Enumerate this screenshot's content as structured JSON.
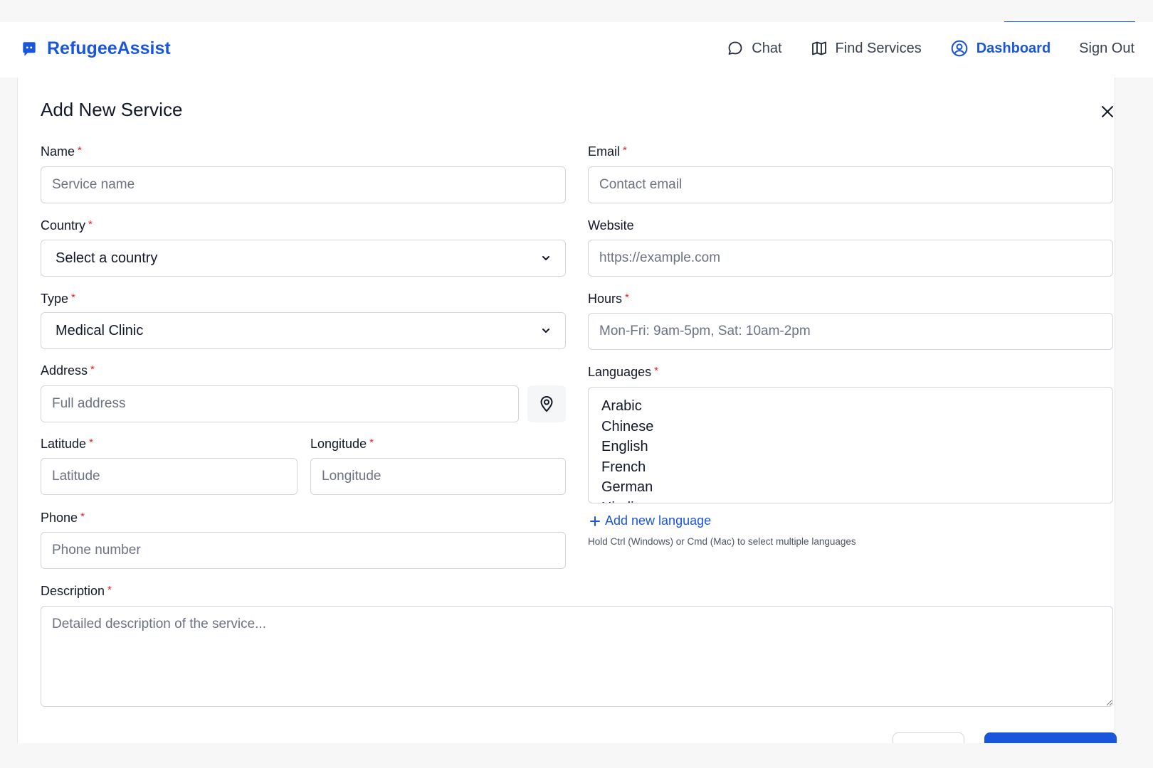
{
  "app": {
    "brand_name": "RefugeeAssist",
    "brand_icon": "chat-bot-icon",
    "brand_color": "#1a56db"
  },
  "nav": {
    "items": [
      {
        "label": "Chat",
        "icon": "chat-bubble-icon"
      },
      {
        "label": "Find Services",
        "icon": "map-icon"
      },
      {
        "label": "Dashboard",
        "icon": "user-circle-icon",
        "active": true
      },
      {
        "label": "Sign Out"
      }
    ]
  },
  "modal": {
    "title": "Add New Service",
    "close_icon": "close-icon"
  },
  "form": {
    "name": {
      "label": "Name",
      "required": "*",
      "placeholder": "Service name",
      "value": ""
    },
    "email": {
      "label": "Email",
      "required": "*",
      "placeholder": "Contact email",
      "value": ""
    },
    "country": {
      "label": "Country",
      "required": "*",
      "selected": "Select a country"
    },
    "website": {
      "label": "Website",
      "placeholder": "https://example.com",
      "value": ""
    },
    "type": {
      "label": "Type",
      "required": "*",
      "selected": "Medical Clinic"
    },
    "hours": {
      "label": "Hours",
      "required": "*",
      "placeholder": "Mon-Fri: 9am-5pm, Sat: 10am-2pm",
      "value": ""
    },
    "address": {
      "label": "Address",
      "required": "*",
      "placeholder": "Full address",
      "value": "",
      "pin_icon": "map-pin-icon"
    },
    "languages": {
      "label": "Languages",
      "required": "*",
      "options": [
        "Arabic",
        "Chinese",
        "English",
        "French",
        "German",
        "Hindi"
      ],
      "add_label": "Add new language",
      "hint": "Hold Ctrl (Windows) or Cmd (Mac) to select multiple languages"
    },
    "latitude": {
      "label": "Latitude",
      "required": "*",
      "placeholder": "Latitude",
      "value": ""
    },
    "longitude": {
      "label": "Longitude",
      "required": "*",
      "placeholder": "Longitude",
      "value": ""
    },
    "phone": {
      "label": "Phone",
      "required": "*",
      "placeholder": "Phone number",
      "value": ""
    },
    "description": {
      "label": "Description",
      "required": "*",
      "placeholder": "Detailed description of the service...",
      "value": ""
    }
  }
}
